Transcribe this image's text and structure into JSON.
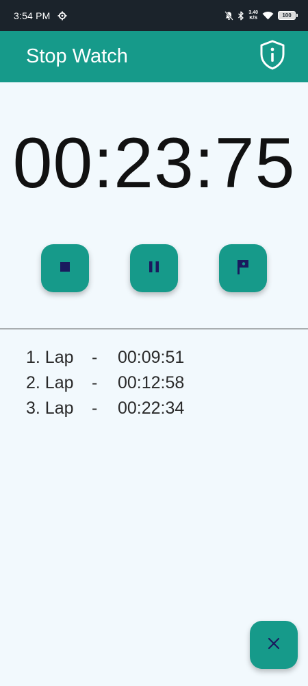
{
  "status_bar": {
    "time": "3:54 PM",
    "net_speed_value": "3.40",
    "net_speed_unit": "K/S",
    "battery": "100",
    "icons": [
      "settings-gear-icon",
      "bell-off-icon",
      "bluetooth-icon",
      "wifi-icon",
      "battery-icon"
    ]
  },
  "app_bar": {
    "title": "Stop Watch",
    "info_icon": "shield-info-icon"
  },
  "timer": {
    "display": "00:23:75"
  },
  "controls": {
    "stop_icon": "stop-icon",
    "pause_icon": "pause-icon",
    "lap_icon": "flag-icon"
  },
  "laps": [
    {
      "label": "1. Lap",
      "separator": "-",
      "time": "00:09:51"
    },
    {
      "label": "2. Lap",
      "separator": "-",
      "time": "00:12:58"
    },
    {
      "label": "3. Lap",
      "separator": "-",
      "time": "00:22:34"
    }
  ],
  "fab": {
    "icon": "close-icon"
  },
  "colors": {
    "accent": "#169a8a",
    "icon_dark": "#1a1a5e",
    "background": "#f2f9fd",
    "status_bar": "#1b232b"
  }
}
